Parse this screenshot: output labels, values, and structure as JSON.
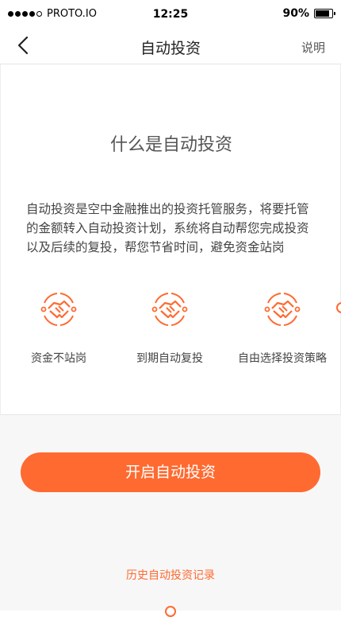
{
  "status_bar": {
    "carrier": "PROTO.IO",
    "time": "12:25",
    "battery": "90%",
    "battery_level": 0.9
  },
  "nav": {
    "title": "自动投资",
    "help": "说明",
    "back_icon": "chevron-left-icon"
  },
  "intro": {
    "heading": "什么是自动投资",
    "description": "自动投资是空中金融推出的投资托管服务，将要托管的金额转入自动投资计划，系统将自动帮您完成投资以及后续的复投，帮您节省时间，避免资金站岗"
  },
  "features": [
    {
      "label": "资金不站岗",
      "icon": "handshake-icon"
    },
    {
      "label": "到期自动复投",
      "icon": "handshake-icon"
    },
    {
      "label": "自由选择投资策略",
      "icon": "handshake-icon"
    }
  ],
  "actions": {
    "primary": "开启自动投资",
    "history": "历史自动投资记录"
  },
  "colors": {
    "accent": "#ff6a30",
    "background": "#f7f7f7"
  }
}
